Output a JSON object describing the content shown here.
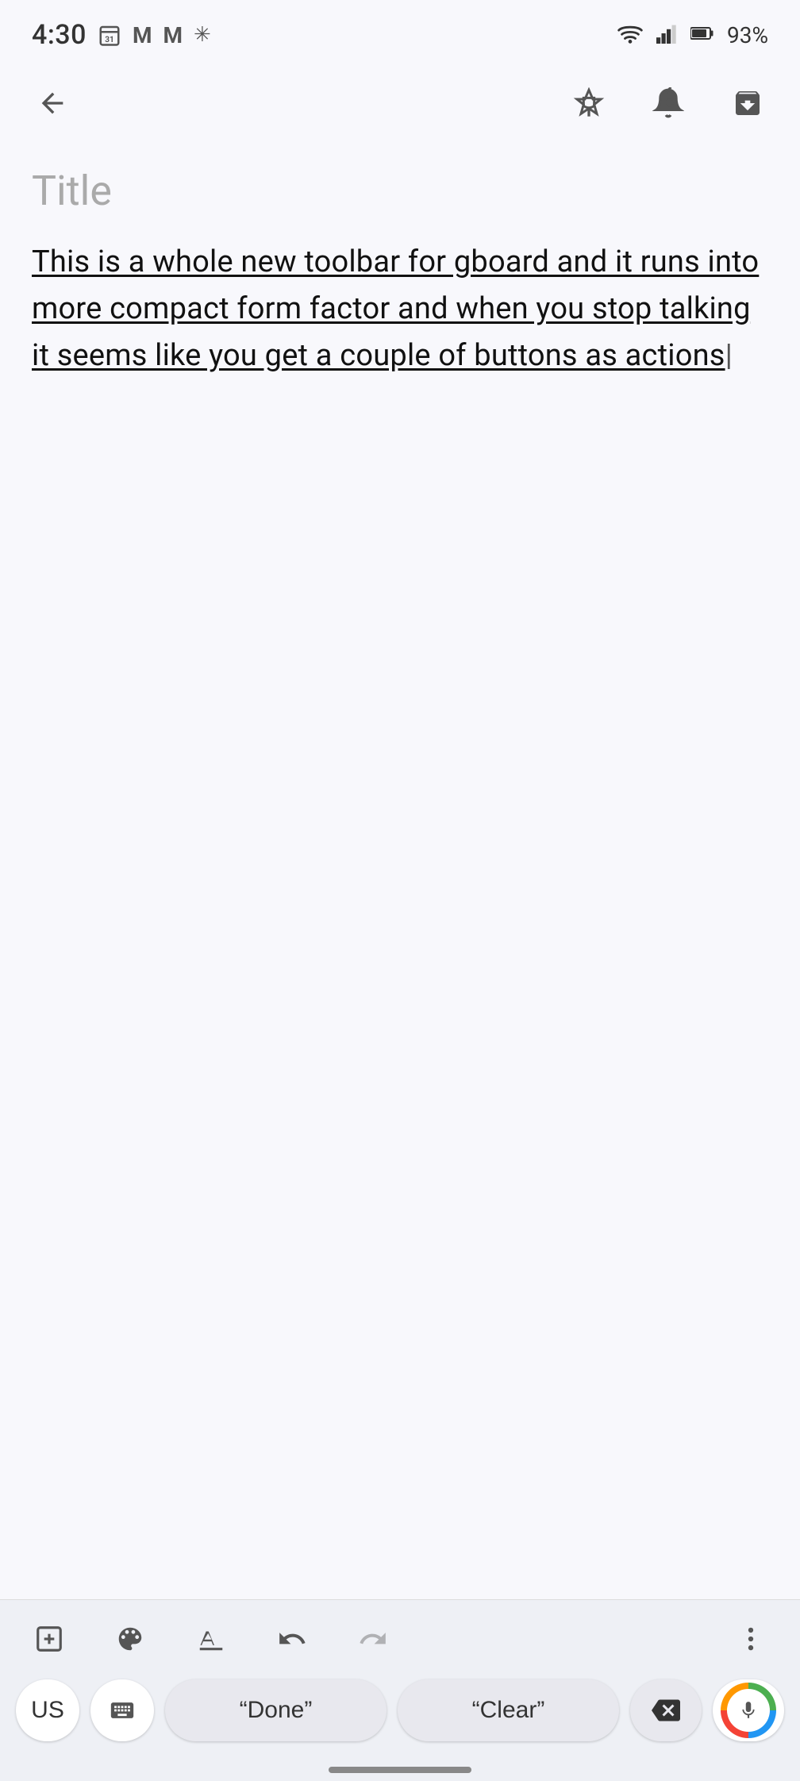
{
  "status": {
    "time": "4:30",
    "battery": "93%",
    "wifi": true,
    "signal": true
  },
  "toolbar": {
    "pin_label": "pin",
    "add_reminder_label": "add reminder",
    "archive_label": "archive"
  },
  "note": {
    "title_placeholder": "Title",
    "body_text": "This is a whole new toolbar for gboard and it runs into more compact form factor and when you stop talking it seems like you get a couple of buttons as actions"
  },
  "keyboard": {
    "toolbar_items": [
      "add",
      "palette",
      "format_text",
      "undo",
      "redo",
      "more"
    ],
    "lang_key": "US",
    "done_key": "“Done”",
    "clear_key": "“Clear”"
  }
}
